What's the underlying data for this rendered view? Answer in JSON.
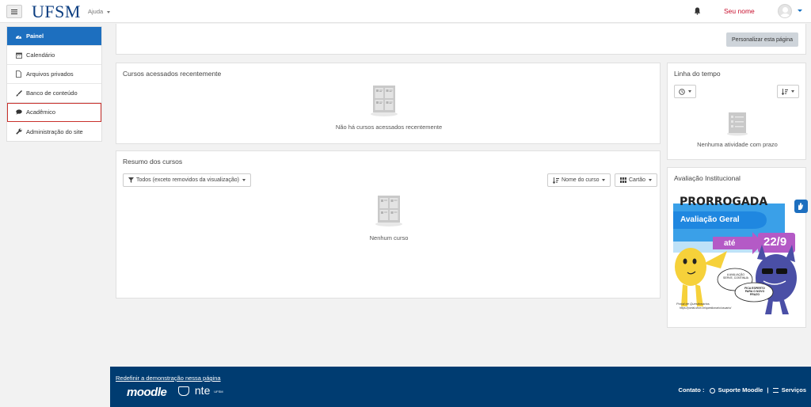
{
  "navbar": {
    "logo": "UFSM",
    "help": "Ajuda",
    "username": "Seu nome"
  },
  "sidebar": {
    "items": [
      {
        "label": "Painel",
        "icon": "dashboard-icon"
      },
      {
        "label": "Calendário",
        "icon": "calendar-icon"
      },
      {
        "label": "Arquivos privados",
        "icon": "file-icon"
      },
      {
        "label": "Banco de conteúdo",
        "icon": "paint-brush-icon"
      },
      {
        "label": "Acadêmico",
        "icon": "comment-icon"
      },
      {
        "label": "Administração do site",
        "icon": "wrench-icon"
      }
    ]
  },
  "page": {
    "customize_button": "Personalizar esta página"
  },
  "recent_courses": {
    "title": "Cursos acessados recentemente",
    "empty_message": "Não há cursos acessados recentemente"
  },
  "course_overview": {
    "title": "Resumo dos cursos",
    "filter_label": "Todos (exceto removidos da visualização)",
    "sort_label": "Nome do curso",
    "view_label": "Cartão",
    "empty_message": "Nenhum curso"
  },
  "timeline": {
    "title": "Linha do tempo",
    "empty_message": "Nenhuma atividade com prazo"
  },
  "evaluation": {
    "title": "Avaliação Institucional",
    "banner": {
      "headline": "PRORROGADA",
      "subtitle": "Avaliação Geral",
      "until": "até",
      "date": "22/9",
      "speech_left": "A AVALIAÇÃO SERVE, CONTINUA",
      "speech_right": "FICA ESPERTO PARA O NOVO PRAZO",
      "portal": "Portal de Questionários",
      "url": "https://portal.ufsm.br/questionario/usuario/"
    }
  },
  "footer": {
    "reset_link": "Redefinir a demonstração nessa página",
    "moodle": "moodle",
    "nte": "nte",
    "nte_sub": "UFSM",
    "contact_label": "Contato :",
    "support": "Suporte Moodle",
    "separator": "|",
    "services": "Serviços"
  },
  "colors": {
    "brand_blue": "#0b3d80",
    "active_blue": "#1d6fbf",
    "footer_blue": "#003c71",
    "username_red": "#c8102e"
  }
}
